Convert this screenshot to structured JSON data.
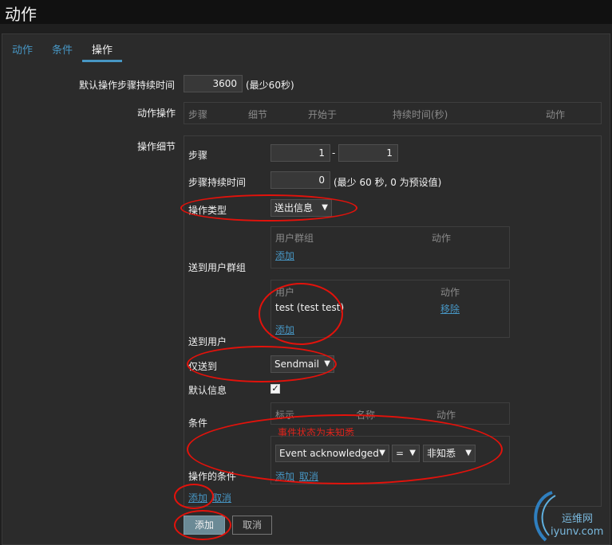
{
  "page": {
    "title": "动作"
  },
  "tabs": [
    {
      "label": "动作"
    },
    {
      "label": "条件"
    },
    {
      "label": "操作"
    }
  ],
  "form": {
    "default_duration_label": "默认操作步骤持续时间",
    "default_duration_value": "3600",
    "default_duration_hint": "(最少60秒)",
    "action_ops_label": "动作操作",
    "ops_columns": [
      "步骤",
      "细节",
      "开始于",
      "持续时间(秒)",
      "动作"
    ],
    "op_details_label": "操作细节"
  },
  "details": {
    "steps_label": "步骤",
    "steps_from": "1",
    "steps_sep": "-",
    "steps_to": "1",
    "step_duration_label": "步骤持续时间",
    "step_duration_value": "0",
    "step_duration_hint": "(最少 60 秒, 0 为预设值)",
    "op_type_label": "操作类型",
    "op_type_value": "送出信息",
    "send_groups_label": "送到用户群组",
    "groups_col_group": "用户群组",
    "groups_col_action": "动作",
    "groups_add": "添加",
    "send_users_label": "送到用户",
    "users_col_user": "用户",
    "users_col_action": "动作",
    "user_name": "test (test test)",
    "user_remove": "移除",
    "users_add": "添加",
    "send_only_label": "仅送到",
    "send_only_value": "Sendmail",
    "default_msg_label": "默认信息",
    "default_msg_checked": "✓",
    "conditions_label": "条件",
    "cond_col_label": "标示",
    "cond_col_name": "名称",
    "cond_col_action": "动作",
    "annotation": "事件状态为未知悉",
    "op_conditions_label": "操作的条件",
    "cond_field_value": "Event acknowledged",
    "cond_operator_value": "=",
    "cond_value_value": "非知悉",
    "cond_add": "添加",
    "cond_cancel": "取消",
    "details_add": "添加",
    "details_cancel": "取消"
  },
  "footer": {
    "add_button": "添加",
    "cancel_button": "取消"
  },
  "watermark": {
    "line1": "运维网",
    "line2": "iyunv.com"
  },
  "colors": {
    "background": "#1f1f1f",
    "panel": "#2b2b2b",
    "link": "#4796c4",
    "annotation_red": "#e3120b"
  }
}
